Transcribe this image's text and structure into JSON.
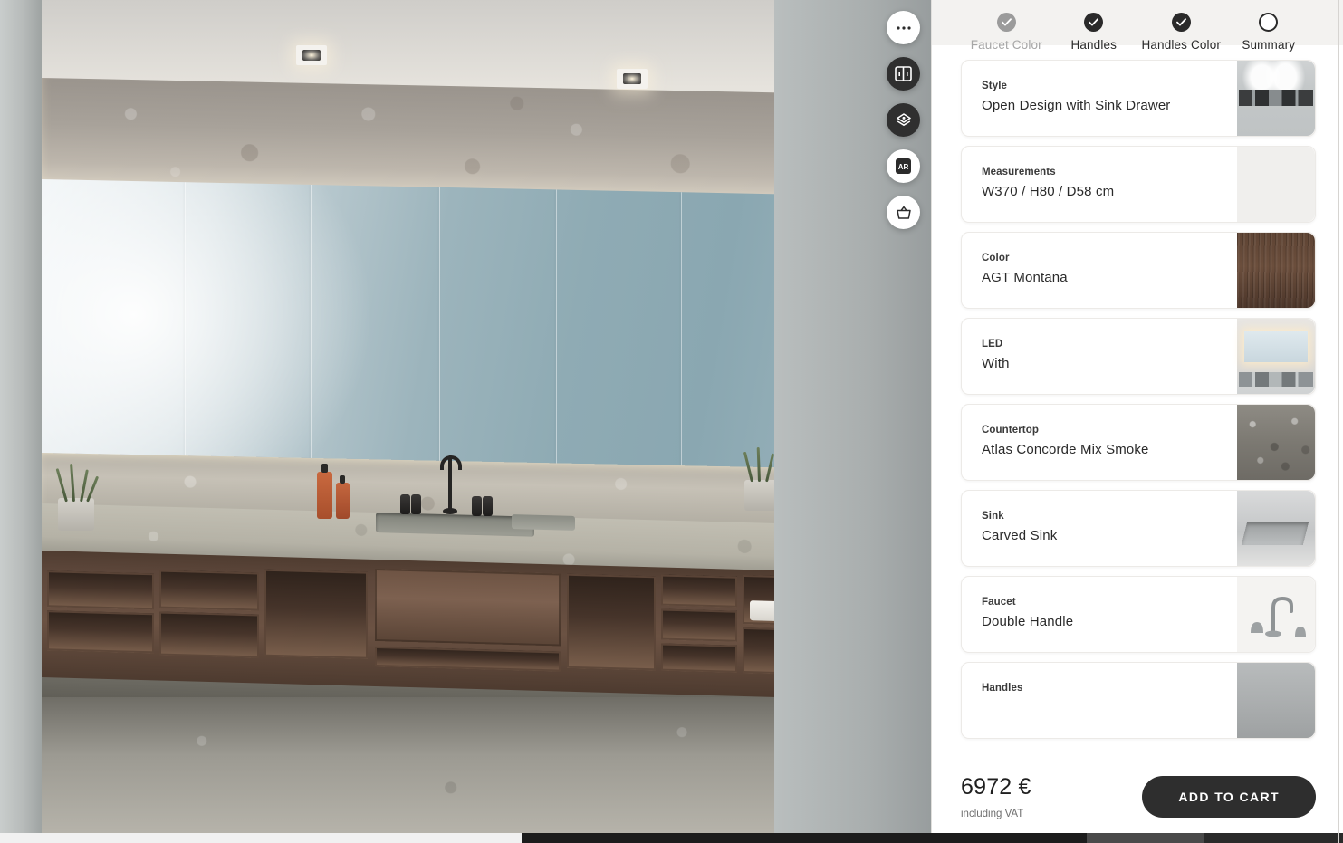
{
  "viewer": {
    "name": "3d-bathroom-render",
    "tools": [
      {
        "id": "more-options",
        "icon": "ellipsis-icon",
        "label": "More options",
        "style": "light"
      },
      {
        "id": "compare-view",
        "icon": "split-view-icon",
        "label": "Compare view",
        "style": "dark"
      },
      {
        "id": "materials",
        "icon": "materials-icon",
        "label": "Materials",
        "style": "dark"
      },
      {
        "id": "ar-view",
        "icon": "ar-icon",
        "label": "AR",
        "style": "light"
      },
      {
        "id": "cart",
        "icon": "basket-icon",
        "label": "Cart",
        "style": "light"
      }
    ]
  },
  "stepper": {
    "steps": [
      {
        "label": "Faucet Color",
        "state": "muted"
      },
      {
        "label": "Handles",
        "state": "done"
      },
      {
        "label": "Handles Color",
        "state": "done"
      },
      {
        "label": "Summary",
        "state": "current"
      }
    ]
  },
  "summary": {
    "items": [
      {
        "label": "Style",
        "value": "Open Design with Sink Drawer",
        "thumb": "th-style",
        "thumb_name": "style-thumbnail"
      },
      {
        "label": "Measurements",
        "value": "W370 / H80 / D58 cm",
        "thumb": "th-plain",
        "thumb_name": "measurements-thumbnail"
      },
      {
        "label": "Color",
        "value": "AGT Montana",
        "thumb": "th-wood",
        "thumb_name": "color-thumbnail"
      },
      {
        "label": "LED",
        "value": "With",
        "thumb": "th-led",
        "thumb_name": "led-thumbnail"
      },
      {
        "label": "Countertop",
        "value": "Atlas Concorde Mix Smoke",
        "thumb": "th-stone",
        "thumb_name": "countertop-thumbnail"
      },
      {
        "label": "Sink",
        "value": "Carved Sink",
        "thumb": "th-sink",
        "thumb_name": "sink-thumbnail"
      },
      {
        "label": "Faucet",
        "value": "Double Handle",
        "thumb": "th-faucet",
        "thumb_name": "faucet-thumbnail"
      },
      {
        "label": "Handles",
        "value": "",
        "thumb": "th-handles",
        "thumb_name": "handles-thumbnail"
      }
    ]
  },
  "footer": {
    "price": "6972 €",
    "price_note": "including VAT",
    "add_to_cart_label": "ADD TO CART"
  },
  "colors": {
    "accent_dark": "#2e2e2e",
    "panel_bg": "#ffffff",
    "stepper_bg": "#f3f2f0",
    "muted_text": "#a6a6a6"
  }
}
